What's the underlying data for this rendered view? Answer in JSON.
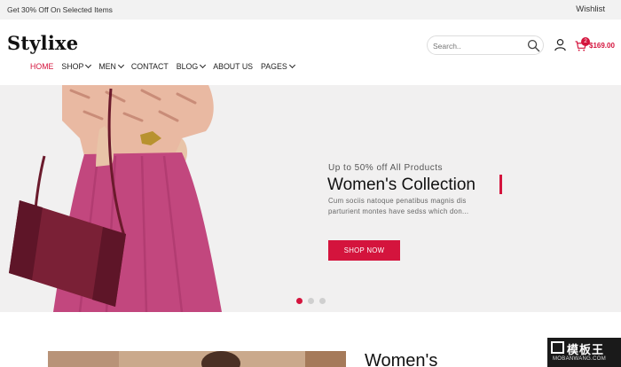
{
  "topbar": {
    "promo": "Get 30% Off On Selected Items",
    "wishlist": "Wishlist"
  },
  "header": {
    "logo": "Stylixe",
    "search": {
      "placeholder": "Search.."
    },
    "cart": {
      "count": "2",
      "total": "$169.00"
    },
    "icons": {
      "search": "search-icon",
      "user": "user-icon",
      "cart": "cart-icon"
    }
  },
  "nav": {
    "items": [
      {
        "label": "HOME",
        "active": true,
        "dropdown": false
      },
      {
        "label": "SHOP",
        "dropdown": true
      },
      {
        "label": "MEN",
        "dropdown": true
      },
      {
        "label": "CONTACT",
        "dropdown": false
      },
      {
        "label": "BLOG",
        "dropdown": true
      },
      {
        "label": "ABOUT US",
        "dropdown": false
      },
      {
        "label": "PAGES",
        "dropdown": true
      }
    ]
  },
  "hero": {
    "kicker": "Up to 50% off All Products",
    "title": "Women's Collection",
    "description": "Cum sociis natoque penatibus magnis dis parturient montes have sedss which don...",
    "button": "SHOP NOW",
    "slides": 3,
    "active_slide": 1
  },
  "section": {
    "title": "Women's"
  },
  "watermark": {
    "cn": "模板王",
    "en": "MOBANWANG.COM"
  },
  "colors": {
    "accent": "#d4143d",
    "topbar_bg": "#f2f2f2",
    "hero_bg": "#f1f0f0"
  }
}
